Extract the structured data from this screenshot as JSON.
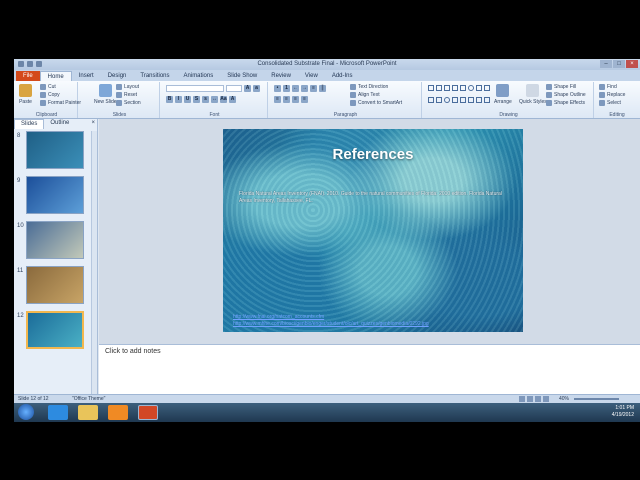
{
  "window": {
    "title": "Consolidated Substrate Final - Microsoft PowerPoint",
    "min_label": "–",
    "max_label": "□",
    "close_label": "×"
  },
  "tabs": [
    "File",
    "Home",
    "Insert",
    "Design",
    "Transitions",
    "Animations",
    "Slide Show",
    "Review",
    "View",
    "Add-Ins"
  ],
  "active_tab": "Home",
  "ribbon": {
    "clipboard": {
      "label": "Clipboard",
      "paste": "Paste",
      "cut": "Cut",
      "copy": "Copy",
      "format_painter": "Format Painter"
    },
    "slides": {
      "label": "Slides",
      "new_slide": "New Slide",
      "layout": "Layout",
      "reset": "Reset",
      "section": "Section"
    },
    "font": {
      "label": "Font"
    },
    "paragraph": {
      "label": "Paragraph",
      "text_direction": "Text Direction",
      "align_text": "Align Text",
      "convert_smartart": "Convert to SmartArt"
    },
    "drawing": {
      "label": "Drawing",
      "arrange": "Arrange",
      "quick_styles": "Quick Styles",
      "shape_fill": "Shape Fill",
      "shape_outline": "Shape Outline",
      "shape_effects": "Shape Effects"
    },
    "editing": {
      "label": "Editing",
      "find": "Find",
      "replace": "Replace",
      "select": "Select"
    }
  },
  "pane": {
    "tab_slides": "Slides",
    "tab_outline": "Outline",
    "close": "×",
    "thumbnails": [
      {
        "number": "8",
        "colors": [
          "#1f5f86",
          "#3b8fb8"
        ]
      },
      {
        "number": "9",
        "colors": [
          "#1c4f9a",
          "#5d9fd8"
        ]
      },
      {
        "number": "10",
        "colors": [
          "#4b6d96",
          "#c2c9b9"
        ]
      },
      {
        "number": "11",
        "colors": [
          "#8a6a3d",
          "#c8a466"
        ]
      },
      {
        "number": "12",
        "colors": [
          "#1b6c99",
          "#4ab0c5"
        ]
      }
    ],
    "selected": "12"
  },
  "slide": {
    "title": "References",
    "body": "Florida Natural Areas Inventory (FNAI). 2010. Guide to the natural communities of Florida: 2010 edition. Florida Natural Areas Inventory, Tallahassee, FL.",
    "link": "http://www.fnai.org/natcom_accounts.cfm http://www.mhhe.com/biosci/genbio/enger/student/olc/art_quizzes/genbiomedia/0292.jpg"
  },
  "notes": {
    "placeholder": "Click to add notes"
  },
  "status": {
    "slide_info": "Slide 12 of 12",
    "theme": "\"Office Theme\"",
    "zoom": "40%"
  },
  "taskbar": {
    "time": "1:01 PM",
    "date": "4/19/2012",
    "colors": {
      "ie": "#2d8be0",
      "explorer": "#e9c45a",
      "media": "#f08a24",
      "powerpoint": "#d24726"
    }
  }
}
